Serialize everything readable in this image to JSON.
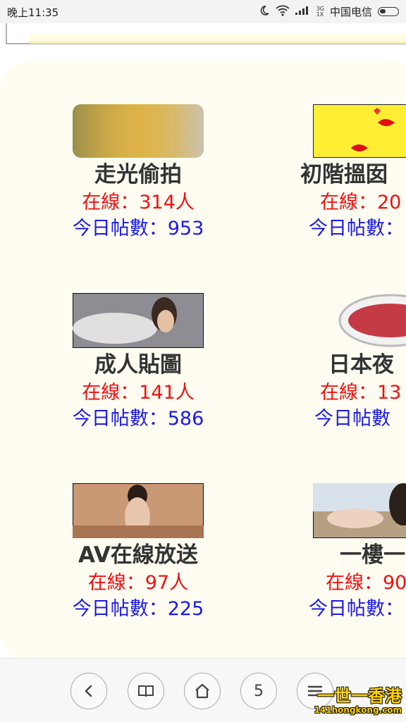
{
  "status_bar": {
    "time": "晚上11:35",
    "net_top": "3G",
    "net_bottom": "1X",
    "carrier": "中国电信"
  },
  "forums": [
    {
      "name": "走光偷拍",
      "online": "在線：314人",
      "posts": "今日帖數：953",
      "thumb_color": "#d9b04a"
    },
    {
      "name": "初階搵囡",
      "online": "在線：20",
      "posts": "今日帖數：",
      "thumb_color": "#ffee33"
    },
    {
      "name": "成人貼圖",
      "online": "在線：141人",
      "posts": "今日帖數：586",
      "thumb_color": "#8d8d93"
    },
    {
      "name": "日本夜",
      "online": "在線：13",
      "posts": "今日帖數",
      "thumb_color": "#c43a45"
    },
    {
      "name": "AV在線放送",
      "online": "在線：97人",
      "posts": "今日帖數：225",
      "thumb_color": "#c99874"
    },
    {
      "name": "一樓一",
      "online": "在線：90",
      "posts": "今日帖數：",
      "thumb_color": "#b6a083"
    }
  ],
  "bottom_nav": {
    "tabs_count": "5"
  },
  "watermark": {
    "main": "一世一香港",
    "sub": "141hongkong.com"
  }
}
